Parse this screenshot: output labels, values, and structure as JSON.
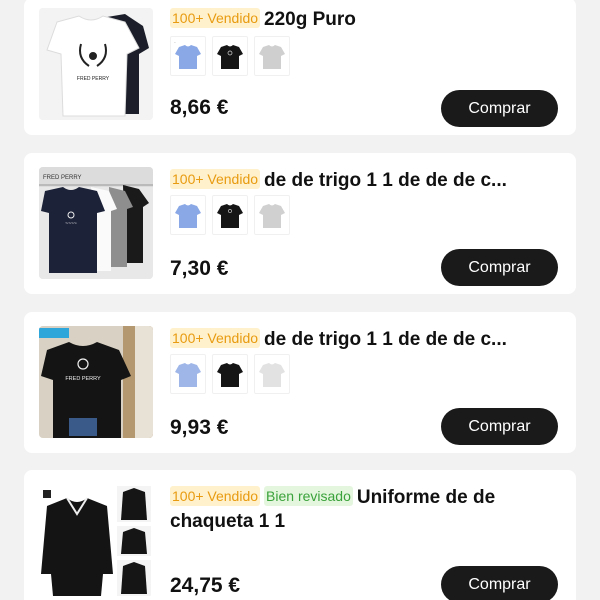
{
  "products": [
    {
      "badges": [
        {
          "text": "100+ Vendido",
          "kind": "sold"
        }
      ],
      "title": "220g Puro",
      "price": "8,66 €",
      "button": "Comprar",
      "swatches": [
        "light-blue-tee-icon",
        "black-tee-icon",
        "grey-tee-icon"
      ]
    },
    {
      "badges": [
        {
          "text": "100+ Vendido",
          "kind": "sold"
        }
      ],
      "title": "de de trigo 1 1 de de de c...",
      "price": "7,30 €",
      "button": "Comprar",
      "swatches": [
        "light-blue-tee-icon",
        "black-tee-icon",
        "grey-tee-icon"
      ]
    },
    {
      "badges": [
        {
          "text": "100+ Vendido",
          "kind": "sold"
        }
      ],
      "title": "de de trigo 1 1 de de de c...",
      "price": "9,93 €",
      "button": "Comprar",
      "swatches": [
        "light-blue-tee-icon",
        "black-tee-icon",
        "white-tee-icon"
      ]
    },
    {
      "badges": [
        {
          "text": "100+ Vendido",
          "kind": "sold"
        },
        {
          "text": "Bien revisado",
          "kind": "review"
        }
      ],
      "title": "Uniforme de de chaqueta 1 1",
      "price": "24,75 €",
      "button": "Comprar",
      "swatches": []
    }
  ],
  "thumb_brand": {
    "product_1": "FRED PERRY",
    "product_2": "FRED PERRY",
    "product_3": "FRED PERRY"
  },
  "colors": {
    "sold_badge_bg": "#fff1cc",
    "sold_badge_text": "#e89b10",
    "review_badge_bg": "#e5f6df",
    "review_badge_text": "#3aa23a",
    "button_bg": "#1a1a1a"
  }
}
